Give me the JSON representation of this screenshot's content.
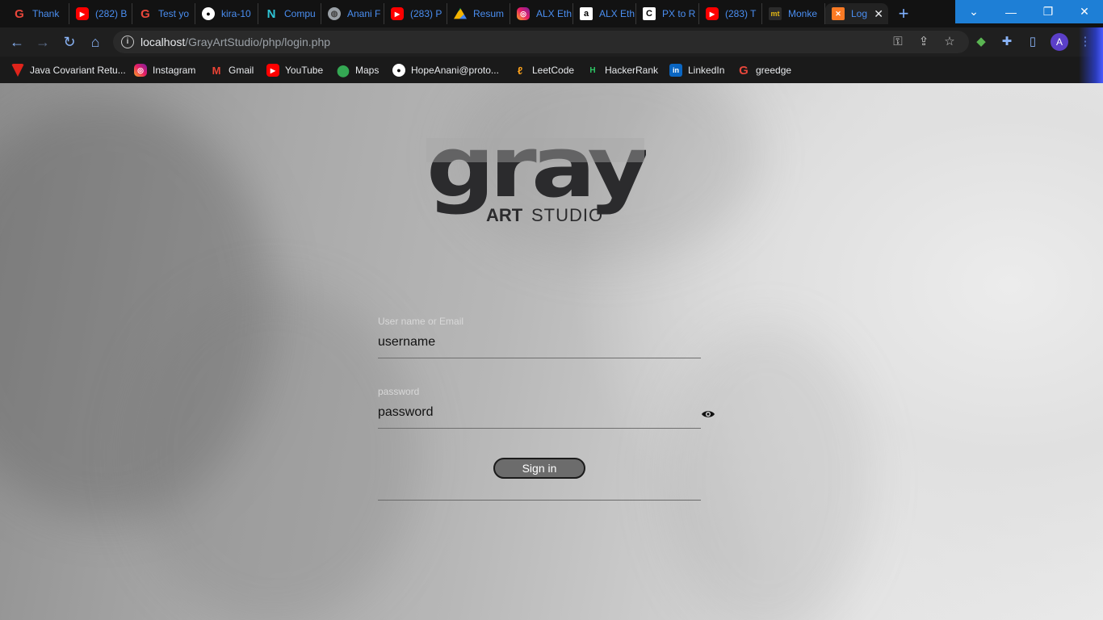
{
  "browser": {
    "tabs": [
      {
        "title": "Thank",
        "icon": "grammarly-icon"
      },
      {
        "title": "(282) B",
        "icon": "youtube-icon"
      },
      {
        "title": "Test yo",
        "icon": "grammarly-icon"
      },
      {
        "title": "kira-10",
        "icon": "github-icon"
      },
      {
        "title": "Compu",
        "icon": "notion-icon"
      },
      {
        "title": "Anani F",
        "icon": "globe-icon"
      },
      {
        "title": "(283) P",
        "icon": "youtube-icon"
      },
      {
        "title": "Resum",
        "icon": "drive-icon"
      },
      {
        "title": "ALX Eth",
        "icon": "instagram-icon"
      },
      {
        "title": "ALX Eth",
        "icon": "alx-icon"
      },
      {
        "title": "PX to R",
        "icon": "px-icon"
      },
      {
        "title": "(283) T",
        "icon": "youtube-icon"
      },
      {
        "title": "Monke",
        "icon": "monkeytype-icon"
      },
      {
        "title": "Log",
        "icon": "xampp-icon",
        "active": true
      }
    ],
    "new_tab": "+",
    "window_controls": {
      "chevron": "⌄",
      "minimize": "—",
      "restore": "❐",
      "close": "✕"
    },
    "url": {
      "host": "localhost",
      "path": "/GrayArtStudio/php/login.php"
    },
    "avatar_letter": "A",
    "bookmarks": [
      {
        "label": "Java Covariant Retu...",
        "icon": "vivaldi-icon"
      },
      {
        "label": "Instagram",
        "icon": "instagram-icon"
      },
      {
        "label": "Gmail",
        "icon": "gmail-icon"
      },
      {
        "label": "YouTube",
        "icon": "youtube-icon"
      },
      {
        "label": "Maps",
        "icon": "maps-icon"
      },
      {
        "label": "HopeAnani@proto...",
        "icon": "protonmail-icon"
      },
      {
        "label": "LeetCode",
        "icon": "leetcode-icon"
      },
      {
        "label": "HackerRank",
        "icon": "hackerrank-icon"
      },
      {
        "label": "LinkedIn",
        "icon": "linkedin-icon"
      },
      {
        "label": "greedge",
        "icon": "grammarly-icon"
      }
    ]
  },
  "login": {
    "logo_word": "gray",
    "logo_sub_bold": "ART",
    "logo_sub_light": "STUDIO",
    "username": {
      "label": "User name or Email",
      "value": "username"
    },
    "password": {
      "label": "password",
      "value": "password"
    },
    "submit_label": "Sign in"
  },
  "colors": {
    "accent": "#8ab4f8",
    "window_controls": "#1e7fd6",
    "button": "#6c6c6c"
  }
}
